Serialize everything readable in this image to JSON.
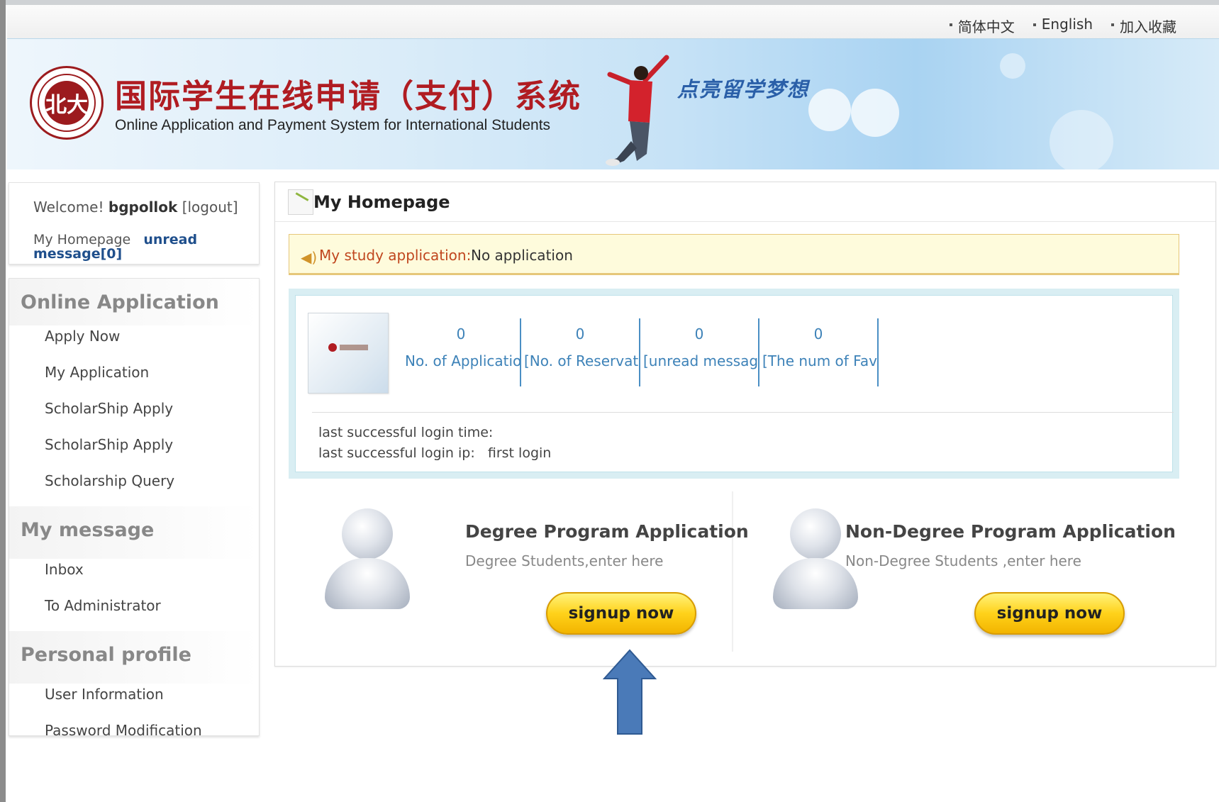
{
  "language_bar": {
    "links": [
      "简体中文",
      "English",
      "加入收藏"
    ]
  },
  "banner": {
    "title_cn": "国际学生在线申请（支付）系统",
    "title_en": "Online Application and Payment  System for International Students",
    "slogan": "点亮留学梦想",
    "logo_char": "北大"
  },
  "user_box": {
    "welcome_prefix": "Welcome!",
    "username": "bgpollok",
    "logout": "[logout]",
    "homepage_link": "My Homepage",
    "unread": "unread message[0]"
  },
  "menu": {
    "online_application": {
      "header": "Online Application",
      "items": [
        "Apply Now",
        "My Application",
        "ScholarShip Apply",
        "ScholarShip Apply",
        "Scholarship Query"
      ]
    },
    "my_message": {
      "header": "My message",
      "items": [
        "Inbox",
        "To Administrator"
      ]
    },
    "personal_profile": {
      "header": "Personal profile",
      "items": [
        "User Information",
        "Password Modification"
      ]
    }
  },
  "main": {
    "title": "My Homepage",
    "notice": {
      "label": "My study application:",
      "value": "No application"
    },
    "stats": [
      {
        "value": "0",
        "label": "No. of Application"
      },
      {
        "value": "0",
        "label": "[No. of Reservation"
      },
      {
        "value": "0",
        "label": "[unread message"
      },
      {
        "value": "0",
        "label": "[The num of Fav"
      }
    ],
    "last_login_time": "last successful login time:",
    "last_login_ip_label": "last successful login ip:",
    "last_login_ip_value": "first login",
    "programs": {
      "degree": {
        "title": "Degree Program Application",
        "subtitle": "Degree Students,enter here",
        "button": "signup now"
      },
      "non_degree": {
        "title": "Non-Degree Program Application",
        "subtitle": "Non-Degree Students ,enter here",
        "button": "signup now"
      }
    }
  },
  "colors": {
    "brand_red": "#b01c22",
    "stat_blue": "#3d82b8",
    "button_yellow": "#ffd21a",
    "annotation_arrow": "#4a7ab8"
  }
}
